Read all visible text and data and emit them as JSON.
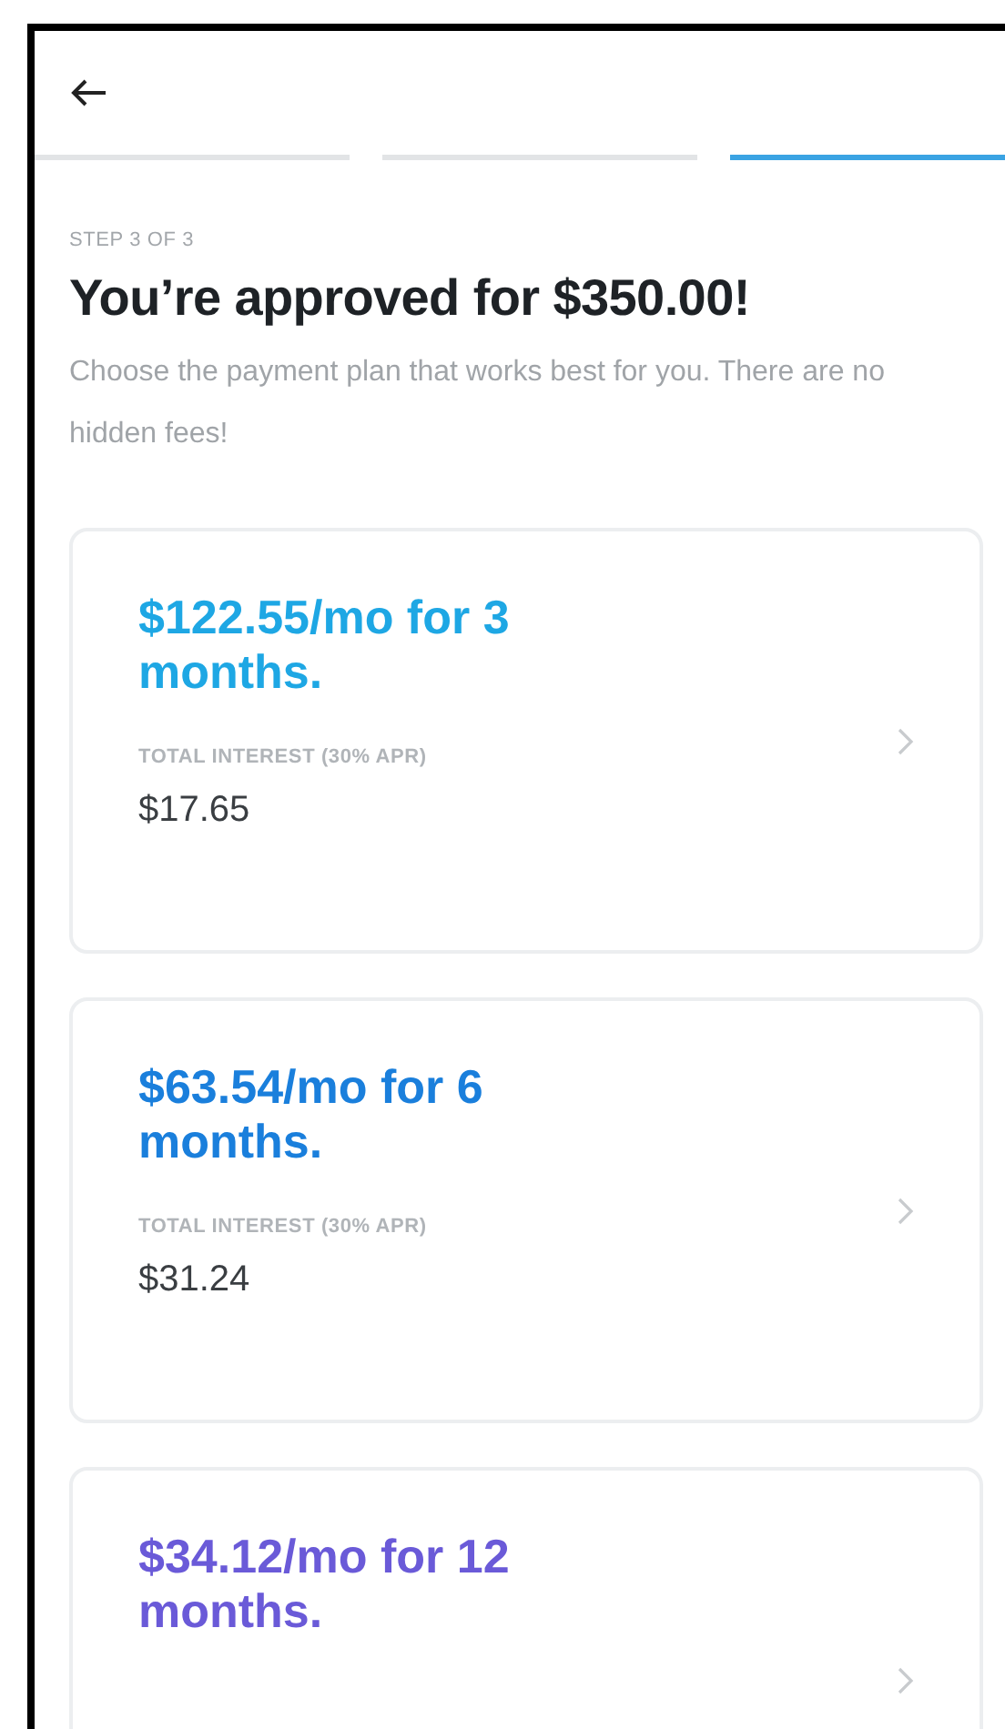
{
  "progress": [
    {
      "active": false
    },
    {
      "active": false
    },
    {
      "active": true
    }
  ],
  "step_label": "STEP 3 OF 3",
  "title": "You’re approved for $350.00!",
  "description": "Choose the payment plan that works best for you. There are no hidden fees!",
  "plans": [
    {
      "title": "$122.55/mo for 3 months.",
      "color": "#1ea7e4",
      "interest_label": "TOTAL INTEREST (30% APR)",
      "interest": "$17.65"
    },
    {
      "title": "$63.54/mo for 6 months.",
      "color": "#1a7fdc",
      "interest_label": "TOTAL INTEREST (30% APR)",
      "interest": "$31.24"
    },
    {
      "title": "$34.12/mo for 12 months.",
      "color": "#6a5ad8"
    }
  ]
}
